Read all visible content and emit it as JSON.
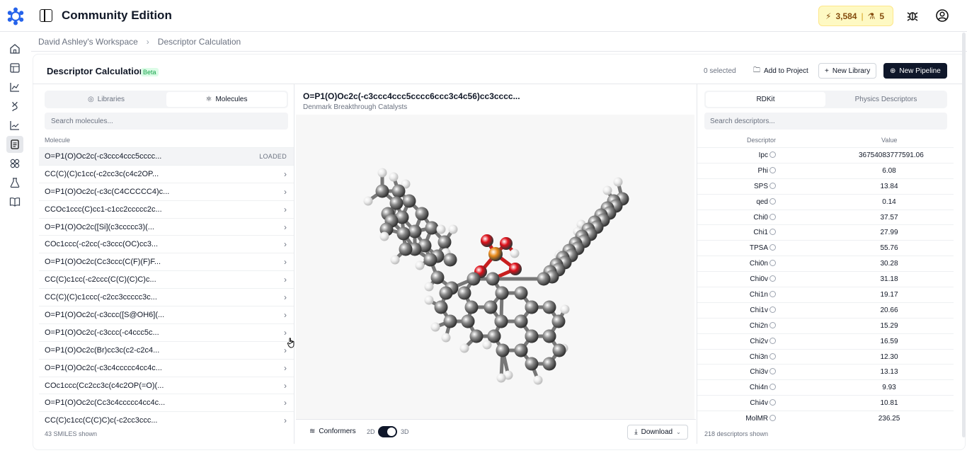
{
  "app": {
    "title": "Community Edition",
    "credits": "3,584",
    "credits_separator": "|",
    "runs": "5"
  },
  "breadcrumb": [
    "David Ashley's Workspace",
    "Descriptor Calculation"
  ],
  "page": {
    "title": "Descriptor Calculation",
    "badge": "Beta",
    "selected": "0 selected",
    "add_to_project": "Add to Project",
    "new_library": "New Library",
    "new_pipeline": "New Pipeline"
  },
  "left": {
    "tabs": [
      "Libraries",
      "Molecules"
    ],
    "search_placeholder": "Search molecules...",
    "column": "Molecule",
    "loaded_tag": "LOADED",
    "rows": [
      "O=P1(O)Oc2c(-c3ccc4ccc5cccc...",
      "CC(C)(C)c1cc(-c2cc3c(c4c2OP...",
      "O=P1(O)Oc2c(-c3c(C4CCCCC4)c...",
      "CCOc1ccc(C)cc1-c1cc2ccccc2c...",
      "O=P1(O)Oc2c([Si](c3ccccc3)(...",
      "COc1ccc(-c2cc(-c3ccc(OC)cc3...",
      "O=P1(O)Oc2c(Cc3ccc(C(F)(F)F...",
      "CC(C)c1cc(-c2ccc(C(C)(C)C)c...",
      "CC(C)(C)c1ccc(-c2cc3ccccc3c...",
      "O=P1(O)Oc2c(-c3ccc([S@OH6](...",
      "O=P1(O)Oc2c(-c3ccc(-c4ccc5c...",
      "O=P1(O)Oc2c(Br)cc3c(c2-c2c4...",
      "O=P1(O)Oc2c(-c3c4ccccc4cc4c...",
      "COc1ccc(Cc2cc3c(c4c2OP(=O)(...",
      "O=P1(O)Oc2c(Cc3c4ccccc4cc4c...",
      "CC(C)c1cc(C(C)C)c(-c2cc3ccc..."
    ],
    "footer": "43 SMILES shown"
  },
  "middle": {
    "title": "O=P1(O)Oc2c(-c3ccc4ccc5cccc6ccc3c4c56)cc3cccc...",
    "subtitle": "Denmark Breakthrough Catalysts",
    "conformers": "Conformers",
    "label_2d": "2D",
    "label_3d": "3D",
    "download": "Download",
    "view_mode": 1
  },
  "right": {
    "tabs": [
      "RDKit",
      "Physics Descriptors"
    ],
    "search_placeholder": "Search descriptors...",
    "col_descriptor": "Descriptor",
    "col_value": "Value",
    "rows": [
      {
        "name": "Ipc",
        "value": "36754083777591.06"
      },
      {
        "name": "Phi",
        "value": "6.08"
      },
      {
        "name": "SPS",
        "value": "13.84"
      },
      {
        "name": "qed",
        "value": "0.14"
      },
      {
        "name": "Chi0",
        "value": "37.57"
      },
      {
        "name": "Chi1",
        "value": "27.99"
      },
      {
        "name": "TPSA",
        "value": "55.76"
      },
      {
        "name": "Chi0n",
        "value": "30.28"
      },
      {
        "name": "Chi0v",
        "value": "31.18"
      },
      {
        "name": "Chi1n",
        "value": "19.17"
      },
      {
        "name": "Chi1v",
        "value": "20.66"
      },
      {
        "name": "Chi2n",
        "value": "15.29"
      },
      {
        "name": "Chi2v",
        "value": "16.59"
      },
      {
        "name": "Chi3n",
        "value": "12.30"
      },
      {
        "name": "Chi3v",
        "value": "13.13"
      },
      {
        "name": "Chi4n",
        "value": "9.93"
      },
      {
        "name": "Chi4v",
        "value": "10.81"
      },
      {
        "name": "MolMR",
        "value": "236.25"
      }
    ],
    "footer": "218 descriptors shown"
  },
  "colors": {
    "accent_dark": "#0f172a",
    "brand": "#2563eb",
    "credits_bg": "#fef9c3",
    "carbon": "#8a8a8a",
    "oxygen": "#e0101a",
    "phosphorus": "#e88a1a",
    "hydrogen": "#eeeeee"
  },
  "icons": {
    "logo": "flower-logo-icon",
    "rail": [
      "home-icon",
      "table-icon",
      "chart-icon",
      "dna-icon",
      "line-chart-icon",
      "clipboard-icon",
      "atom-icon",
      "flask-icon",
      "book-icon"
    ]
  }
}
